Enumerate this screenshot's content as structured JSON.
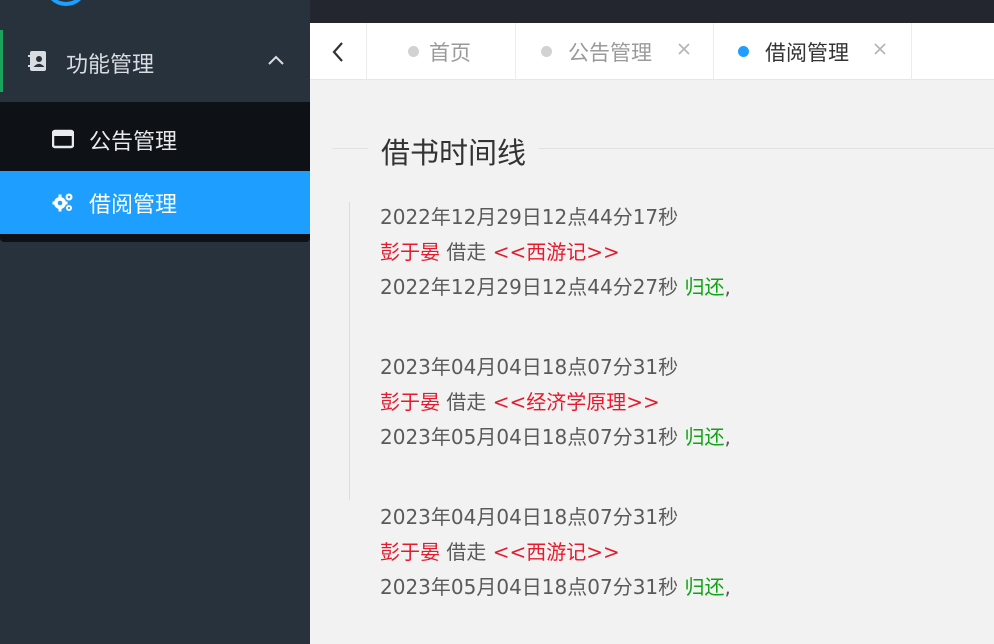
{
  "sidebar": {
    "parent_label": "功能管理",
    "items": [
      {
        "label": "公告管理",
        "active": false
      },
      {
        "label": "借阅管理",
        "active": true
      }
    ]
  },
  "tabs": [
    {
      "label": "首页",
      "active": false,
      "closable": false
    },
    {
      "label": "公告管理",
      "active": false,
      "closable": true
    },
    {
      "label": "借阅管理",
      "active": true,
      "closable": true
    }
  ],
  "content": {
    "title": "借书时间线",
    "records": [
      {
        "borrow_time": "2022年12月29日12点44分17秒",
        "person": "彭于晏",
        "action": "借走",
        "book": "<<西游记>>",
        "return_time": "2022年12月29日12点44分27秒",
        "return_label": "归还",
        "suffix": ","
      },
      {
        "borrow_time": "2023年04月04日18点07分31秒",
        "person": "彭于晏",
        "action": "借走",
        "book": "<<经济学原理>>",
        "return_time": "2023年05月04日18点07分31秒",
        "return_label": "归还",
        "suffix": ","
      },
      {
        "borrow_time": "2023年04月04日18点07分31秒",
        "person": "彭于晏",
        "action": "借走",
        "book": "<<西游记>>",
        "return_time": "2023年05月04日18点07分31秒",
        "return_label": "归还",
        "suffix": ","
      }
    ]
  },
  "colors": {
    "sidebar_bg": "#28323c",
    "submenu_bg": "#0e1115",
    "active_blue": "#1e9fff",
    "accent_green": "#1aa35a",
    "person_red": "#e8192c",
    "return_green": "#11a316"
  },
  "icons": {
    "parent": "contacts-book-icon",
    "notice": "window-icon",
    "borrow": "gears-icon",
    "back": "chevron-left-icon",
    "collapse": "chevron-up-icon",
    "close": "close-icon"
  }
}
